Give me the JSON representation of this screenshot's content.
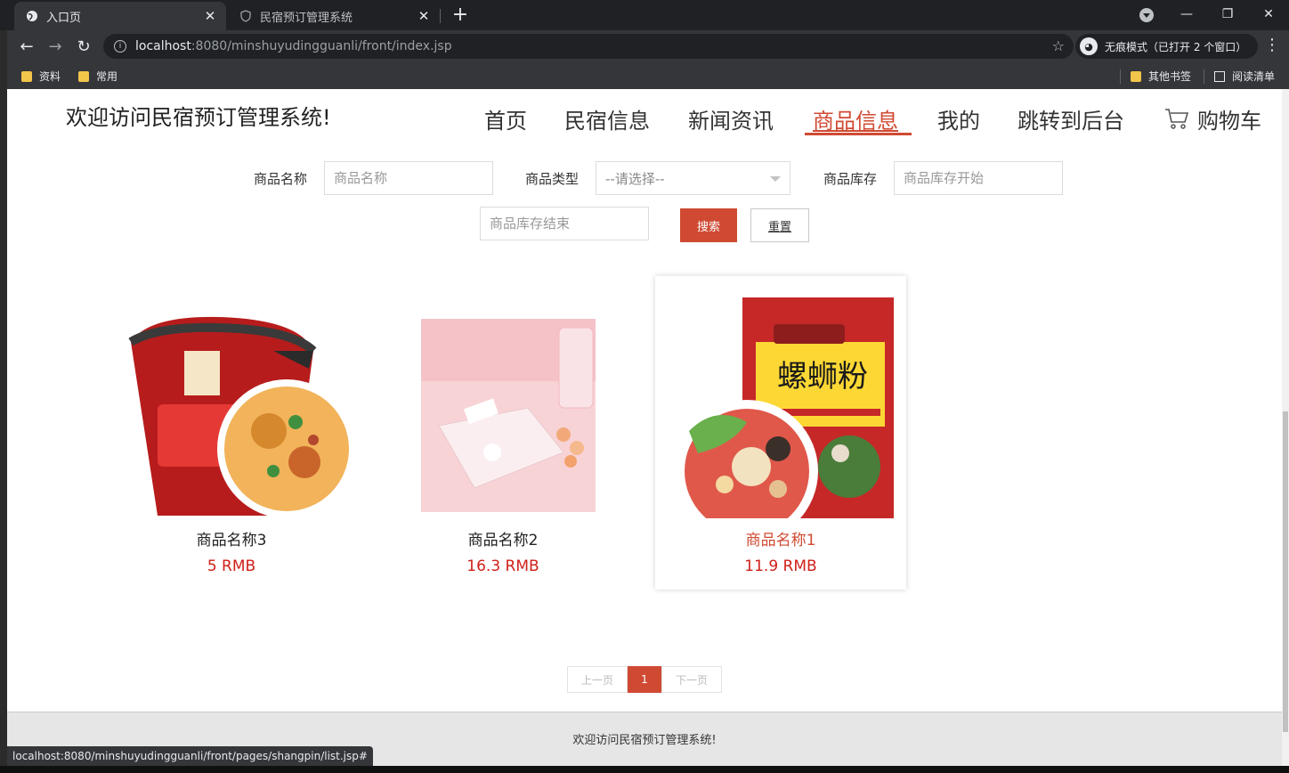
{
  "browser": {
    "tabs": [
      {
        "title": "入口页",
        "active": true
      },
      {
        "title": "民宿预订管理系统",
        "active": false
      }
    ],
    "url_host": "localhost",
    "url_rest": ":8080/minshuyudingguanli/front/index.jsp",
    "incognito_label": "无痕模式（已打开 2 个窗口）",
    "bookmarks": [
      "资料",
      "常用"
    ],
    "bookmarks_right": [
      "其他书签",
      "阅读清单"
    ],
    "status_url": "localhost:8080/minshuyudingguanli/front/pages/shangpin/list.jsp#"
  },
  "site": {
    "title": "欢迎访问民宿预订管理系统!",
    "nav": [
      "首页",
      "民宿信息",
      "新闻资讯",
      "商品信息",
      "我的",
      "跳转到后台",
      "购物车"
    ],
    "active_nav": "商品信息"
  },
  "search": {
    "name_label": "商品名称",
    "name_placeholder": "商品名称",
    "type_label": "商品类型",
    "type_selected": "--请选择--",
    "stock_label": "商品库存",
    "stock_start_placeholder": "商品库存开始",
    "stock_end_placeholder": "商品库存结束",
    "search_btn": "搜索",
    "reset_btn": "重置"
  },
  "products": [
    {
      "name": "商品名称3",
      "price": "5 RMB",
      "image": "instant-noodle-cup"
    },
    {
      "name": "商品名称2",
      "price": "16.3 RMB",
      "image": "snack-plate"
    },
    {
      "name": "商品名称1",
      "price": "11.9 RMB",
      "image": "luosifen-package"
    }
  ],
  "pager": {
    "prev": "上一页",
    "current": "1",
    "next": "下一页"
  },
  "footer": {
    "text": "欢迎访问民宿预订管理系统!"
  },
  "colors": {
    "accent": "#d04a33",
    "price": "#d0201a"
  }
}
